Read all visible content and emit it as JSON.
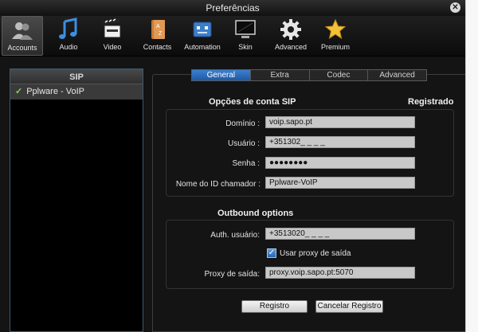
{
  "window": {
    "title": "Preferências"
  },
  "toolbar": {
    "items": [
      {
        "label": "Accounts",
        "icon": "accounts-icon"
      },
      {
        "label": "Audio",
        "icon": "music-note-icon"
      },
      {
        "label": "Video",
        "icon": "clapperboard-icon"
      },
      {
        "label": "Contacts",
        "icon": "address-book-icon"
      },
      {
        "label": "Automation",
        "icon": "robot-icon"
      },
      {
        "label": "Skin",
        "icon": "monitor-icon"
      },
      {
        "label": "Advanced",
        "icon": "gear-icon"
      },
      {
        "label": "Premium",
        "icon": "star-icon"
      }
    ]
  },
  "sidebar": {
    "header": "SIP",
    "items": [
      {
        "label": "Pplware - VoIP",
        "check": "✓"
      }
    ]
  },
  "tabs": [
    "General",
    "Extra",
    "Codec",
    "Advanced"
  ],
  "sip_options": {
    "title": "Opções de conta SIP",
    "status": "Registrado",
    "domain_label": "Domínio :",
    "domain_value": "voip.sapo.pt",
    "user_label": "Usuário :",
    "user_value": "+351302_ _ _ _",
    "password_label": "Senha :",
    "password_value": "●●●●●●●●",
    "caller_id_label": "Nome do ID chamador :",
    "caller_id_value": "Pplware-VoIP"
  },
  "outbound": {
    "title": "Outbound options",
    "auth_user_label": "Auth. usuário:",
    "auth_user_value": "+3513020_ _ _ _",
    "use_proxy_label": "Usar proxy de saída",
    "use_proxy_checked": true,
    "proxy_label": "Proxy de saída:",
    "proxy_value": "proxy.voip.sapo.pt:5070"
  },
  "buttons": {
    "register": "Registro",
    "cancel_register": "Cancelar Registro"
  }
}
